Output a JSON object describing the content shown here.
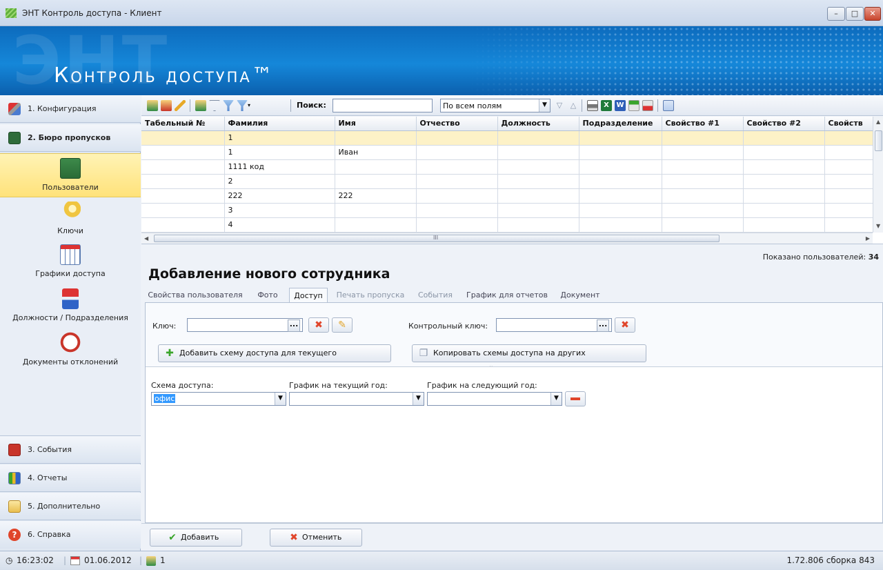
{
  "window": {
    "title": "ЭНТ Контроль доступа - Клиент",
    "minimize": "–",
    "maximize": "□",
    "close": "✕"
  },
  "banner": {
    "logo_text": "Контроль доступа™",
    "ghost_text": "ЭНТ"
  },
  "sidebar": {
    "top_items": [
      {
        "label": "1. Конфигурация",
        "icon": "wrench-icon"
      },
      {
        "label": "2. Бюро пропусков",
        "icon": "id-card-icon"
      }
    ],
    "sub_items": [
      {
        "label": "Пользователи",
        "icon": "users-icon"
      },
      {
        "label": "Ключи",
        "icon": "key-icon"
      },
      {
        "label": "Графики доступа",
        "icon": "calendar-icon"
      },
      {
        "label": "Должности / Подразделения",
        "icon": "org-chart-icon"
      },
      {
        "label": "Документы отклонений",
        "icon": "clock-doc-icon"
      }
    ],
    "bottom_items": [
      {
        "label": "3. События",
        "icon": "events-book-icon"
      },
      {
        "label": "4. Отчеты",
        "icon": "reports-chart-icon"
      },
      {
        "label": "5. Дополнительно",
        "icon": "envelope-icon"
      },
      {
        "label": "6. Справка",
        "icon": "help-icon"
      }
    ]
  },
  "toolbar": {
    "search_label": "Поиск:",
    "search_value": "",
    "field_select": "По всем полям"
  },
  "grid": {
    "columns": [
      "Табельный №",
      "Фамилия",
      "Имя",
      "Отчество",
      "Должность",
      "Подразделение",
      "Свойство #1",
      "Свойство #2",
      "Свойств"
    ],
    "rows": [
      [
        "",
        "1",
        "",
        "",
        "",
        "",
        "",
        "",
        ""
      ],
      [
        "",
        "1",
        "Иван",
        "",
        "",
        "",
        "",
        "",
        ""
      ],
      [
        "",
        "1111 код",
        "",
        "",
        "",
        "",
        "",
        "",
        ""
      ],
      [
        "",
        "2",
        "",
        "",
        "",
        "",
        "",
        "",
        ""
      ],
      [
        "",
        "222",
        "222",
        "",
        "",
        "",
        "",
        "",
        ""
      ],
      [
        "",
        "3",
        "",
        "",
        "",
        "",
        "",
        "",
        ""
      ],
      [
        "",
        "4",
        "",
        "",
        "",
        "",
        "",
        "",
        ""
      ]
    ],
    "scroll_marker": "III"
  },
  "status_count": {
    "label": "Показано пользователей:",
    "value": "34"
  },
  "form": {
    "title": "Добавление нового сотрудника",
    "tabs": [
      {
        "label": "Свойства пользователя",
        "state": "normal"
      },
      {
        "label": "Фото",
        "state": "normal"
      },
      {
        "label": "Доступ",
        "state": "active"
      },
      {
        "label": "Печать пропуска",
        "state": "disabled"
      },
      {
        "label": "События",
        "state": "disabled"
      },
      {
        "label": "График для отчетов",
        "state": "normal"
      },
      {
        "label": "Документ",
        "state": "normal"
      }
    ],
    "key_label": "Ключ:",
    "key_value": "",
    "control_key_label": "Контрольный ключ:",
    "control_key_value": "",
    "ellipsis": "...",
    "add_scheme_button": "Добавить схему доступа для текущего пользователя",
    "copy_scheme_button": "Копировать схемы доступа на других пользователей",
    "scheme_label": "Схема доступа:",
    "scheme_value": "офис",
    "current_year_label": "График на текущий год:",
    "current_year_value": "",
    "next_year_label": "График на следующий год:",
    "next_year_value": "",
    "add_button": "Добавить",
    "cancel_button": "Отменить"
  },
  "footer": {
    "time": "16:23:02",
    "date": "01.06.2012",
    "users_online": "1",
    "version": "1.72.806 сборка 843"
  },
  "colors": {
    "banner": "#1587d9",
    "selected_row": "#fdf2c7",
    "active_nav": "#ffe27a",
    "delete_red": "#e0452a",
    "add_green": "#3aa52b"
  }
}
